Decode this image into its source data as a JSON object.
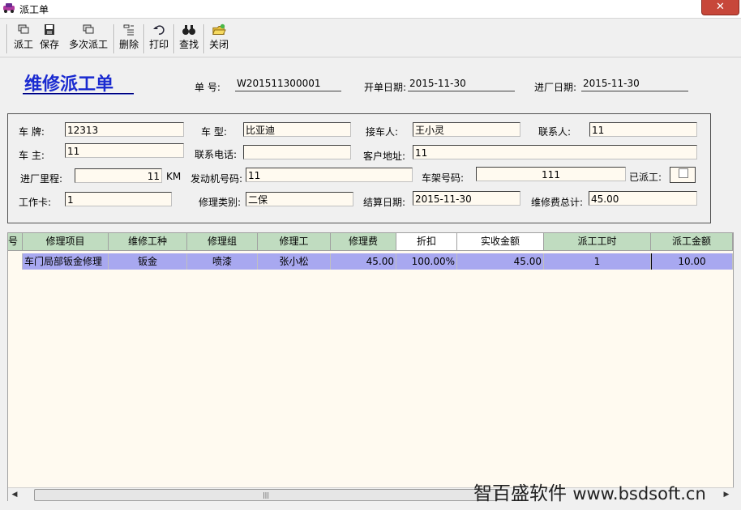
{
  "window": {
    "title": "派工单",
    "close_glyph": "✕"
  },
  "toolbar": {
    "items": [
      {
        "label": "派工",
        "icon": "dispatch-icon"
      },
      {
        "label": "保存",
        "icon": "save-icon"
      },
      {
        "label": "多次派工",
        "icon": "multi-dispatch-icon"
      },
      {
        "label": "删除",
        "icon": "delete-icon"
      },
      {
        "label": "打印",
        "icon": "print-icon"
      },
      {
        "label": "查找",
        "icon": "find-icon"
      },
      {
        "label": "关闭",
        "icon": "close-icon"
      }
    ]
  },
  "header": {
    "form_title": "维修派工单",
    "order_no_label": "单  号:",
    "order_no": "W201511300001",
    "open_date_label": "开单日期:",
    "open_date": "2015-11-30",
    "entry_date_label": "进厂日期:",
    "entry_date": "2015-11-30"
  },
  "fields": {
    "plate_label": "车  牌:",
    "plate": "12313",
    "model_label": "车  型:",
    "model": "比亚迪",
    "receiver_label": "接车人:",
    "receiver": "王小灵",
    "contact_label": "联系人:",
    "contact": "11",
    "owner_label": "车  主:",
    "owner": "11",
    "phone_label": "联系电话:",
    "phone": "",
    "address_label": "客户地址:",
    "address": "11",
    "mileage_label": "进厂里程:",
    "mileage": "11",
    "mileage_unit": "KM",
    "engine_label": "发动机号码:",
    "engine": "11",
    "vin_label": "车架号码:",
    "vin": "111",
    "dispatched_label": "已派工:",
    "card_label": "工作卡:",
    "card": "1",
    "repair_type_label": "修理类别:",
    "repair_type": "二保",
    "settle_date_label": "结算日期:",
    "settle_date": "2015-11-30",
    "total_label": "维修费总计:",
    "total": "45.00"
  },
  "grid": {
    "columns": [
      "号",
      "修理项目",
      "维修工种",
      "修理组",
      "修理工",
      "修理费",
      "折扣",
      "实收金额",
      "派工工时",
      "派工金额"
    ],
    "rows": [
      [
        "",
        "车门局部钣金修理",
        "钣金",
        "喷漆",
        "张小松",
        "45.00",
        "100.00%",
        "45.00",
        "1",
        "10.00"
      ]
    ]
  },
  "watermark": {
    "text": "智百盛软件",
    "url": "www.bsdsoft.cn"
  },
  "colors": {
    "title_blue": "#1a2ad0",
    "grid_header": "#c0dcc0",
    "grid_row_selected": "#a8a8f0",
    "input_bg": "#fffaf0",
    "close_red": "#c7473a"
  }
}
